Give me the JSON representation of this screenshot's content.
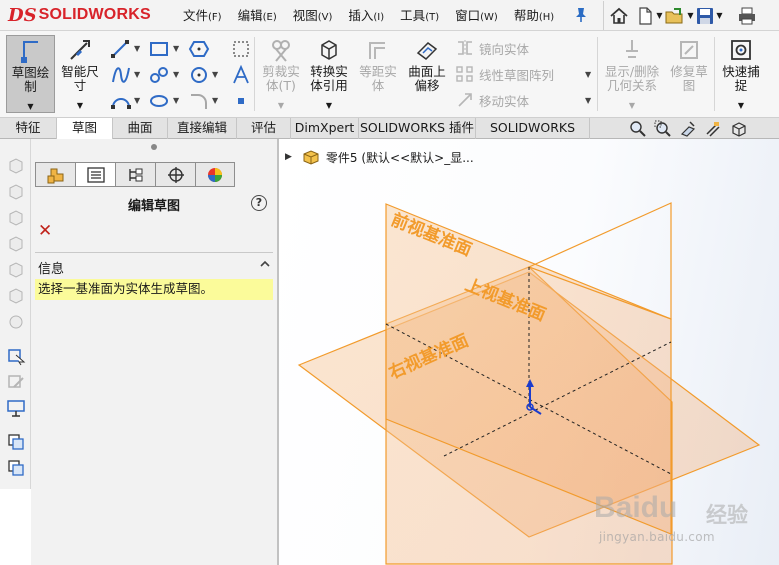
{
  "app": {
    "logo_ds": "DS",
    "logo_name": "SOLIDWORKS",
    "brand_color": "#d8232a"
  },
  "menu": [
    {
      "label": "文件",
      "key": "(F)"
    },
    {
      "label": "编辑",
      "key": "(E)"
    },
    {
      "label": "视图",
      "key": "(V)"
    },
    {
      "label": "插入",
      "key": "(I)"
    },
    {
      "label": "工具",
      "key": "(T)"
    },
    {
      "label": "窗口",
      "key": "(W)"
    },
    {
      "label": "帮助",
      "key": "(H)"
    }
  ],
  "quick_access": [
    "home-icon",
    "new-document-icon",
    "open-folder-icon",
    "save-icon",
    "print-icon"
  ],
  "ribbon": {
    "sketch": "草图绘\n制",
    "smart_dim": "智能尺\n寸",
    "trim": "剪裁实\n体(T)",
    "convert": "转换实\n体引用",
    "offset": "等距实\n体",
    "offset_surface": "曲面上\n偏移",
    "mirror": "镜向实体",
    "linear_pattern": "线性草图阵列",
    "move": "移动实体",
    "display_relations": "显示/删除\n几何关系",
    "repair": "修复草\n图",
    "rapid_snap": "快速捕\n捉"
  },
  "tabs": [
    "特征",
    "草图",
    "曲面",
    "直接编辑",
    "评估",
    "DimXpert",
    "SOLIDWORKS 插件",
    "SOLIDWORKS MBD"
  ],
  "active_tab": "草图",
  "property_manager": {
    "title": "编辑草图",
    "help": "?",
    "close": "✕",
    "info_header": "信息",
    "info_message": "选择一基准面为实体生成草图。"
  },
  "feature_tree": {
    "part_label": "零件5  (默认<<默认>_显..."
  },
  "planes": {
    "front": "前视基准面",
    "top": "上视基准面",
    "right": "右视基准面",
    "color": "#f29b2c"
  },
  "watermark": {
    "main": "Baidu",
    "cn": "经验",
    "url": "jingyan.baidu.com"
  }
}
